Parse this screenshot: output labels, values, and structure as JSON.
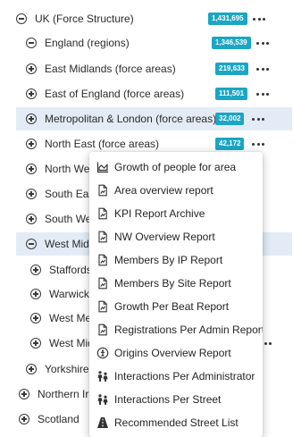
{
  "tree": [
    {
      "id": "uk",
      "label": "UK (Force Structure)",
      "badge": "1,431,695",
      "expanded": true,
      "selected": false
    },
    {
      "id": "england",
      "label": "England (regions)",
      "badge": "1,346,539",
      "expanded": true,
      "selected": false
    },
    {
      "id": "east-midlands",
      "label": "East Midlands (force areas)",
      "badge": "219,633",
      "expanded": false,
      "selected": false
    },
    {
      "id": "east-of-england",
      "label": "East of England (force areas)",
      "badge": "111,501",
      "expanded": false,
      "selected": false
    },
    {
      "id": "metropolitan-london",
      "label": "Metropolitan & London (force areas)",
      "badge": "32,002",
      "expanded": false,
      "selected": true
    },
    {
      "id": "north-east",
      "label": "North East (force areas)",
      "badge": "42,172",
      "expanded": false,
      "selected": false
    },
    {
      "id": "north-west",
      "label": "North West",
      "badge": "",
      "expanded": false,
      "selected": false
    },
    {
      "id": "south-east",
      "label": "South East",
      "badge": "",
      "expanded": false,
      "selected": false
    },
    {
      "id": "south-west",
      "label": "South West",
      "badge": "",
      "expanded": false,
      "selected": false
    },
    {
      "id": "west-midlands",
      "label": "West Midla",
      "badge": "",
      "expanded": true,
      "selected": true
    },
    {
      "id": "staffordshire",
      "label": "Staffordsh",
      "badge": "",
      "expanded": false,
      "selected": false
    },
    {
      "id": "warwickshire",
      "label": "Warwicksh",
      "badge": "",
      "expanded": false,
      "selected": false
    },
    {
      "id": "west-mercia",
      "label": "West Merc",
      "badge": "",
      "expanded": false,
      "selected": false
    },
    {
      "id": "west-midlands-police",
      "label": "West Midl",
      "badge": "",
      "expanded": false,
      "selected": false
    },
    {
      "id": "yorkshire",
      "label": "Yorkshire &",
      "badge": "",
      "expanded": false,
      "selected": false
    },
    {
      "id": "northern-ireland",
      "label": "Northern Ire",
      "badge": "",
      "expanded": false,
      "selected": false
    },
    {
      "id": "scotland",
      "label": "Scotland",
      "badge": "",
      "expanded": false,
      "selected": false
    }
  ],
  "context_menu": {
    "items": [
      {
        "label": "Growth of people for area",
        "icon": "area-chart-icon"
      },
      {
        "label": "Area overview report",
        "icon": "report-document-icon"
      },
      {
        "label": "KPI Report Archive",
        "icon": "report-document-icon"
      },
      {
        "label": "NW Overview Report",
        "icon": "report-document-icon"
      },
      {
        "label": "Members By IP Report",
        "icon": "report-document-icon"
      },
      {
        "label": "Members By Site Report",
        "icon": "report-document-icon"
      },
      {
        "label": "Growth Per Beat Report",
        "icon": "report-document-icon"
      },
      {
        "label": "Registrations Per Admin Report",
        "icon": "report-document-icon"
      },
      {
        "label": "Origins Overview Report",
        "icon": "origins-icon"
      },
      {
        "label": "Interactions Per Administrator",
        "icon": "interactions-icon"
      },
      {
        "label": "Interactions Per Street",
        "icon": "interactions-icon"
      },
      {
        "label": "Recommended Street List",
        "icon": "road-icon"
      }
    ]
  },
  "colors": {
    "badge": "#1aa6c4",
    "selected_row": "#e3ecf6",
    "text": "#2b2b2b"
  }
}
